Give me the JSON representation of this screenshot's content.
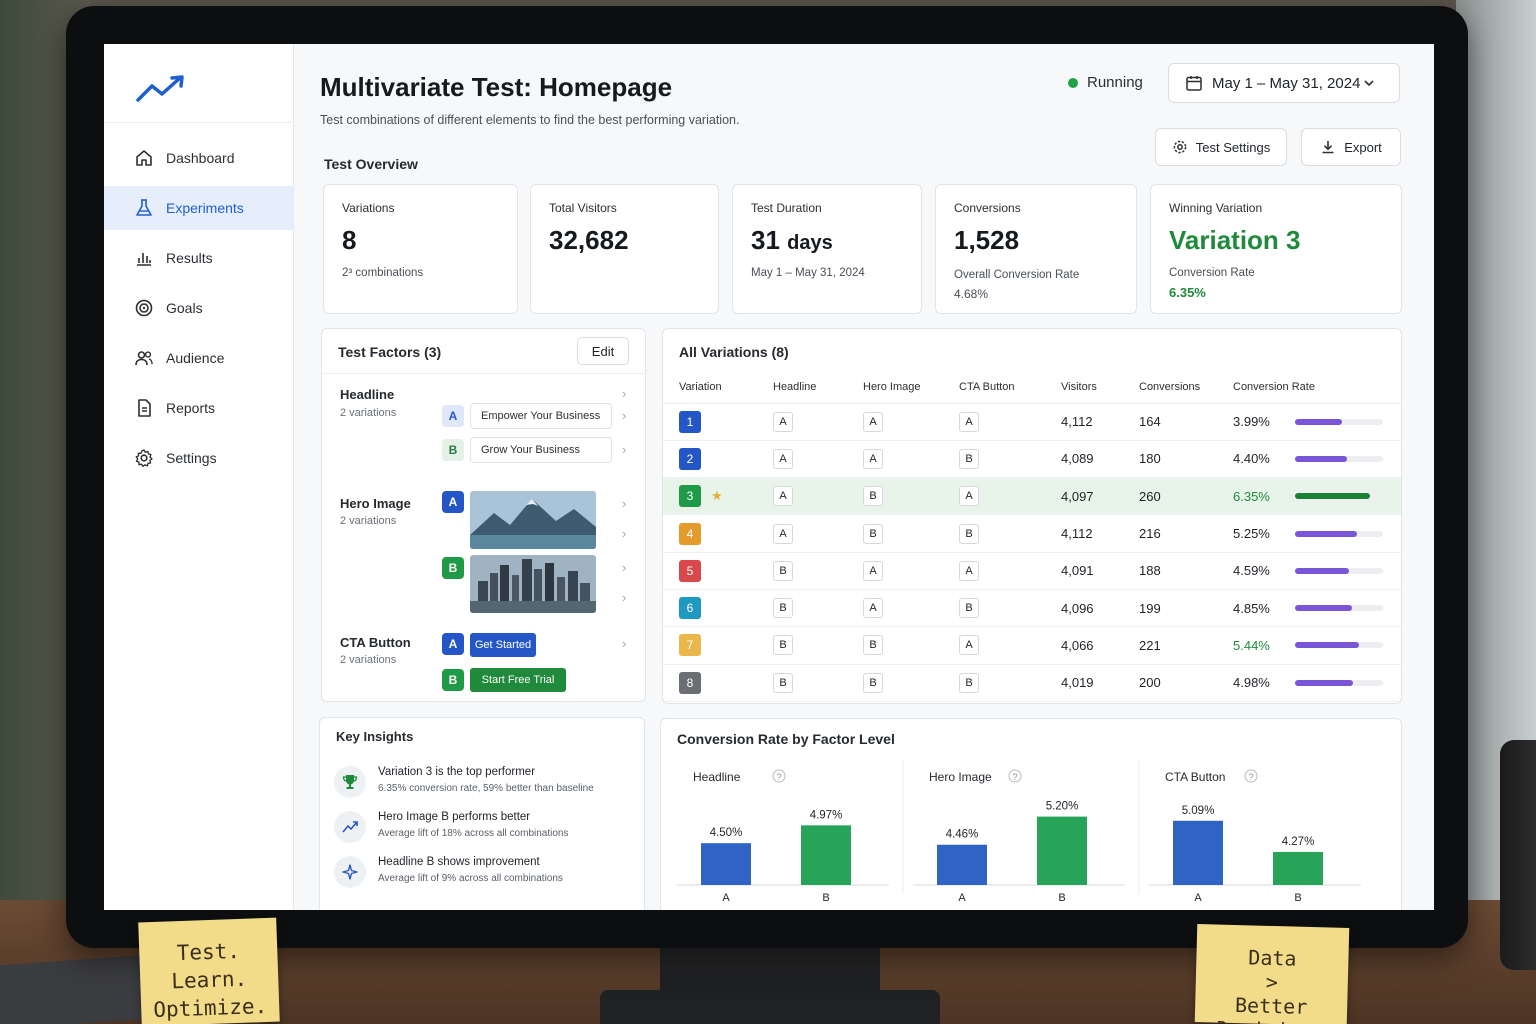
{
  "app": {
    "title": "Multivariate Test: Homepage",
    "subtitle": "Test combinations of different elements to find the best performing variation."
  },
  "sidebar": {
    "items": [
      {
        "label": "Dashboard",
        "icon": "home-icon"
      },
      {
        "label": "Experiments",
        "icon": "flask-icon",
        "active": true
      },
      {
        "label": "Results",
        "icon": "bar-chart-icon"
      },
      {
        "label": "Goals",
        "icon": "target-icon"
      },
      {
        "label": "Audience",
        "icon": "users-icon"
      },
      {
        "label": "Reports",
        "icon": "document-icon"
      },
      {
        "label": "Settings",
        "icon": "gear-icon"
      }
    ]
  },
  "header": {
    "status": "Running",
    "date_range": "May 1 – May 31, 2024",
    "test_settings": "Test Settings",
    "export": "Export",
    "status_color": "#1fa34a"
  },
  "overview": {
    "title": "Test Overview",
    "variations": {
      "label": "Variations",
      "value": "8",
      "sub": "2³ combinations"
    },
    "visitors": {
      "label": "Total Visitors",
      "value": "32,682"
    },
    "duration": {
      "label": "Test Duration",
      "value": "31",
      "unit": "days",
      "sub": "May 1 – May 31, 2024"
    },
    "conversions": {
      "label": "Conversions",
      "value": "1,528",
      "sub_label": "Overall Conversion Rate",
      "sub_value": "4.68%"
    },
    "winner": {
      "label": "Winning Variation",
      "value": "Variation 3",
      "sub_label": "Conversion Rate",
      "sub_value": "6.35%"
    }
  },
  "factors": {
    "title": "Test Factors (3)",
    "edit": "Edit",
    "headline": {
      "name": "Headline",
      "sub": "2 variations",
      "a": "Empower Your Business",
      "b": "Grow Your Business"
    },
    "hero": {
      "name": "Hero Image",
      "sub": "2 variations"
    },
    "cta": {
      "name": "CTA Button",
      "sub": "2 variations",
      "a": "Get Started",
      "b": "Start Free Trial"
    },
    "letter_a": "A",
    "letter_b": "B"
  },
  "variations": {
    "title": "All Variations (8)",
    "columns": [
      "Variation",
      "Headline",
      "Hero Image",
      "CTA Button",
      "Visitors",
      "Conversions",
      "Conversion Rate"
    ],
    "rows": [
      {
        "id": "1",
        "color": "#2457c5",
        "h": "A",
        "hero": "A",
        "cta": "A",
        "visitors": "4,112",
        "conv": "164",
        "rate": "3.99%",
        "r": 3.99
      },
      {
        "id": "2",
        "color": "#2457c5",
        "h": "A",
        "hero": "A",
        "cta": "B",
        "visitors": "4,089",
        "conv": "180",
        "rate": "4.40%",
        "r": 4.4
      },
      {
        "id": "3",
        "color": "#1f9a48",
        "h": "A",
        "hero": "B",
        "cta": "A",
        "visitors": "4,097",
        "conv": "260",
        "rate": "6.35%",
        "r": 6.35,
        "winner": true
      },
      {
        "id": "4",
        "color": "#e59a2c",
        "h": "A",
        "hero": "B",
        "cta": "B",
        "visitors": "4,112",
        "conv": "216",
        "rate": "5.25%",
        "r": 5.25
      },
      {
        "id": "5",
        "color": "#d9484b",
        "h": "B",
        "hero": "A",
        "cta": "A",
        "visitors": "4,091",
        "conv": "188",
        "rate": "4.59%",
        "r": 4.59
      },
      {
        "id": "6",
        "color": "#1f98c2",
        "h": "B",
        "hero": "A",
        "cta": "B",
        "visitors": "4,096",
        "conv": "199",
        "rate": "4.85%",
        "r": 4.85
      },
      {
        "id": "7",
        "color": "#eab84a",
        "h": "B",
        "hero": "B",
        "cta": "A",
        "visitors": "4,066",
        "conv": "221",
        "rate": "5.44%",
        "r": 5.44,
        "rate_green": true
      },
      {
        "id": "8",
        "color": "#6b6e72",
        "h": "B",
        "hero": "B",
        "cta": "B",
        "visitors": "4,019",
        "conv": "200",
        "rate": "4.98%",
        "r": 4.98
      }
    ],
    "bar_max": 7.5,
    "bar_color": "#7a55d6",
    "winner_bar_color": "#1a7f37"
  },
  "insights": {
    "title": "Key Insights",
    "items": [
      {
        "title": "Variation 3 is the top performer",
        "sub": "6.35% conversion rate, 59% better than baseline",
        "icon": "trophy-icon"
      },
      {
        "title": "Hero Image B performs better",
        "sub": "Average lift of 18% across all combinations",
        "icon": "trend-up-icon"
      },
      {
        "title": "Headline B shows improvement",
        "sub": "Average lift of 9% across all combinations",
        "icon": "sparkle-icon"
      }
    ]
  },
  "chart_data": {
    "type": "bar",
    "title": "Conversion Rate by Factor Level",
    "panels": [
      {
        "name": "Headline",
        "categories": [
          "A",
          "B"
        ],
        "values": [
          4.5,
          4.97
        ],
        "labels": [
          "4.50%",
          "4.97%"
        ]
      },
      {
        "name": "Hero Image",
        "categories": [
          "A",
          "B"
        ],
        "values": [
          4.46,
          5.2
        ],
        "labels": [
          "4.46%",
          "5.20%"
        ]
      },
      {
        "name": "CTA Button",
        "categories": [
          "A",
          "B"
        ],
        "values": [
          5.09,
          4.27
        ],
        "labels": [
          "5.09%",
          "4.27%"
        ]
      }
    ],
    "ylim": [
      3.4,
      5.4
    ],
    "colors": {
      "A": "#2f63c4",
      "B": "#27a35a"
    },
    "help": "?"
  },
  "notes": {
    "left": [
      "Test.",
      "Learn.",
      "Optimize."
    ],
    "right": [
      "Data",
      ">",
      "Better Decisions"
    ]
  }
}
